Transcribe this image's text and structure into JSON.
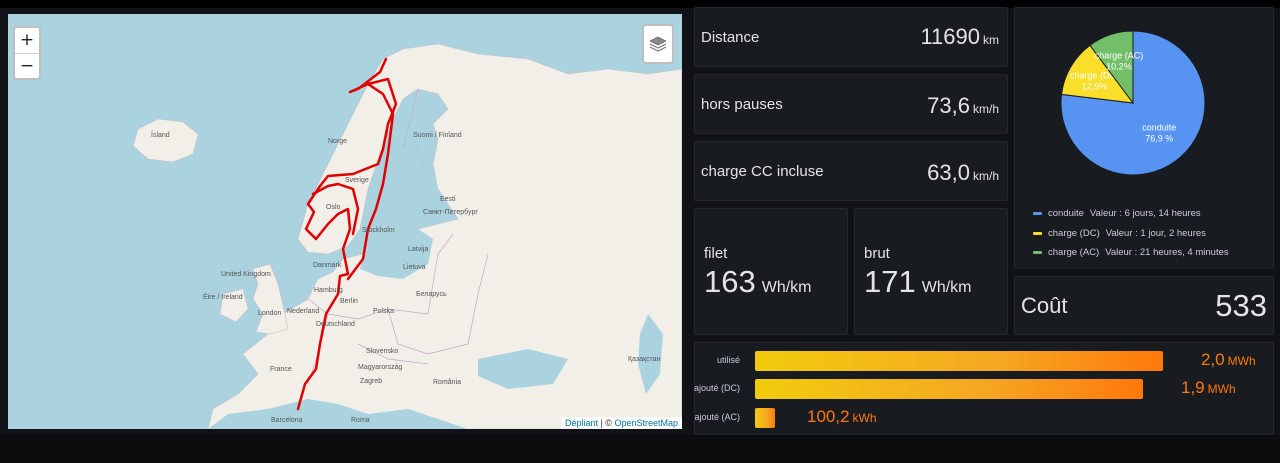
{
  "map": {
    "zoom_in": "+",
    "zoom_out": "−",
    "attribution_leaflet": "Dépliant",
    "attribution_sep": " | © ",
    "attribution_osm": "OpenStreetMap",
    "labels": {
      "island": "Ísland",
      "norge": "Norge",
      "sverige": "Sverige",
      "suomi": "Suomi / Finland",
      "eesti": "Eesti",
      "oslo": "Oslo",
      "stockholm": "Stockholm",
      "spb": "Санкт-Петербург",
      "uk": "United Kingdom",
      "eire": "Éire / Ireland",
      "london": "London",
      "danmark": "Danmark",
      "hamburg": "Hamburg",
      "berlin": "Berlin",
      "nederland": "Nederland",
      "polska": "Polska",
      "deutschland": "Deutschland",
      "belarus": "Беларусь",
      "lietuva": "Lietuva",
      "latvija": "Latvija",
      "france": "France",
      "slovensko": "Slovensko",
      "magyar": "Magyarország",
      "zagreb": "Zagreb",
      "romania": "România",
      "kazakh": "Қазақстан",
      "barcelona": "Barcelona",
      "roma": "Roma"
    }
  },
  "stats": {
    "distance": {
      "label": "Distance",
      "value": "11690",
      "unit": "km"
    },
    "hors_pauses": {
      "label": "hors pauses",
      "value": "73,6",
      "unit": "km/h"
    },
    "charge_cc": {
      "label": "charge CC incluse",
      "value": "63,0",
      "unit": "km/h"
    },
    "filet": {
      "label": "filet",
      "value": "163",
      "unit": "Wh/km"
    },
    "brut": {
      "label": "brut",
      "value": "171",
      "unit": "Wh/km"
    },
    "cout": {
      "label": "Coût",
      "value": "533"
    }
  },
  "pie": {
    "colors": {
      "conduite": "#5794f2",
      "charge_dc": "#fade2a",
      "charge_ac": "#73bf69"
    },
    "slices": [
      {
        "name": "conduite",
        "percent": 76.9,
        "pct_label": "76,9 %"
      },
      {
        "name": "charge (DC)",
        "percent": 12.9,
        "pct_label": "12,9%"
      },
      {
        "name": "charge (AC)",
        "percent": 10.2,
        "pct_label": "10,2%"
      }
    ],
    "legend": [
      {
        "name": "conduite",
        "value": "Valeur : 6 jours, 14 heures"
      },
      {
        "name": "charge (DC)",
        "value": "Valeur : 1 jour, 2 heures"
      },
      {
        "name": "charge (AC)",
        "value": "Valeur : 21 heures, 4 minutes"
      }
    ]
  },
  "energy": {
    "rows": [
      {
        "label": "utilisé",
        "value": "2,0",
        "unit": "MWh",
        "fraction": 1.0
      },
      {
        "label": "ajouté (DC)",
        "value": "1,9",
        "unit": "MWh",
        "fraction": 0.95
      },
      {
        "label": "ajouté (AC)",
        "value": "100,2",
        "unit": "kWh",
        "fraction": 0.05
      }
    ]
  }
}
